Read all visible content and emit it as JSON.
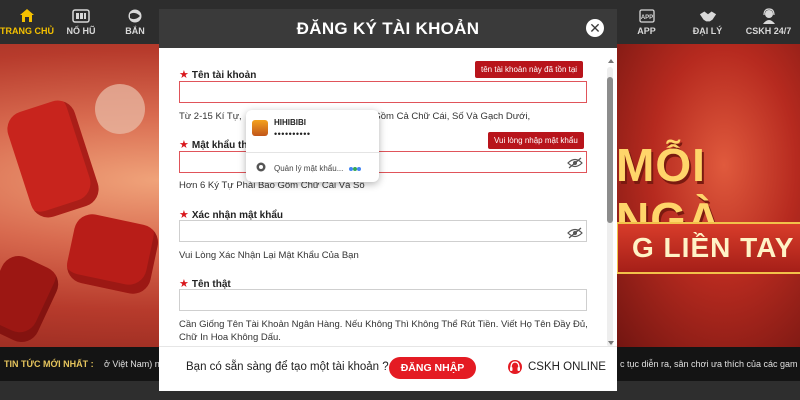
{
  "nav": {
    "left": [
      {
        "label": "TRANG CHỦ",
        "icon": "home-icon",
        "active": true
      },
      {
        "label": "NỔ HŨ",
        "icon": "slot-machine-icon"
      },
      {
        "label": "BẮN",
        "icon": "fish-shooting-icon"
      }
    ],
    "right": [
      {
        "label": "APP",
        "icon": "app-icon"
      },
      {
        "label": "ĐẠI LÝ",
        "icon": "handshake-icon"
      },
      {
        "label": "CSKH 24/7",
        "icon": "support-agent-icon"
      }
    ]
  },
  "banner": {
    "slogan_line1": "MỖI NGÀ",
    "slogan_line2": "G LIỀN TAY"
  },
  "ticker": {
    "title": "TIN TỨC MỚI NHẤT :",
    "left_text": "ở Việt Nam) ng",
    "right_text": "c tục diễn ra, sân chơi ưa thích của các gam"
  },
  "modal": {
    "title": "ĐĂNG KÝ TÀI KHOẢN",
    "fields": [
      {
        "label": "Tên tài khoản",
        "value": "",
        "error_tip": "tên tài khoản này đã tồn tại",
        "hint": "Từ 2-15 Kí Tự, Phải Bao Gồm Cả Chữ Cái, Số Và Gạch Dưới,",
        "hint_visible_start": "Từ 2-15 Kí Tự, ",
        "hint_visible_end": "Thể Gồm Cả Chữ Cái, Số Và Gạch Dưới,"
      },
      {
        "label": "Mật khẩu",
        "label_visible": "Mật khẩu th",
        "value": "",
        "error_tip": "Vui lòng nhập mật khẩu",
        "hint": "Hơn 6 Ký Tự Phải Bao Gồm Chữ Cái Và Số"
      },
      {
        "label": "Xác nhận mật khẩu",
        "value": "",
        "hint": "Vui Lòng Xác Nhận Lại Mật Khẩu Của Bạn"
      },
      {
        "label": "Tên thật",
        "value": "",
        "hint_line1": "Cần Giống Tên Tài Khoản Ngân Hàng. Nếu Không Thì Không Thể Rút Tiền. Viết Họ Tên Đầy Đủ,",
        "hint_line2": "Chữ In Hoa Không Dấu."
      }
    ],
    "footer_text": "Bạn có sẵn sàng để tạo một tài khoản ?",
    "login_button": "ĐĂNG NHẬP",
    "cskh_label": "CSKH ONLINE"
  },
  "autofill": {
    "username": "HIHIBIBI",
    "password_mask": "••••••••••",
    "manage_label": "Quản lý mật khẩu..."
  },
  "colors": {
    "accent_red": "#e41b23",
    "error_red": "#b8141b",
    "nav_active": "#f5c100",
    "header_dark": "#3a3a3a"
  }
}
